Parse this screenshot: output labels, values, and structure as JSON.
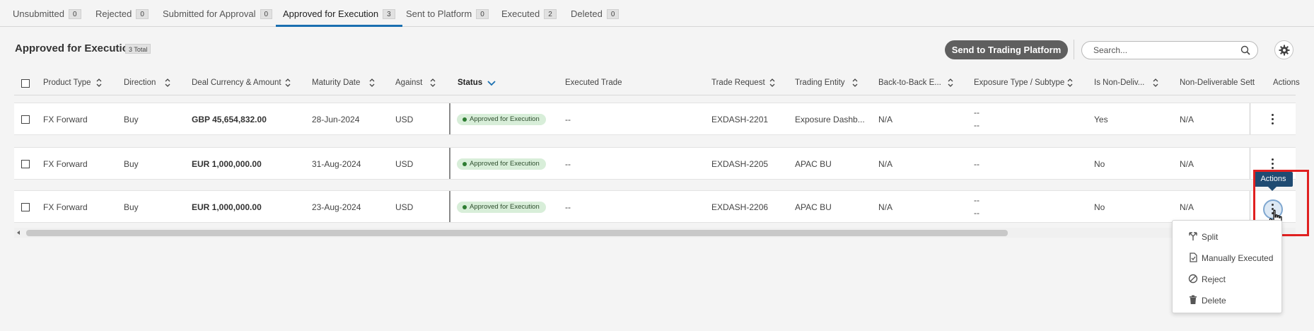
{
  "tabs": [
    {
      "label": "Unsubmitted",
      "count": "0"
    },
    {
      "label": "Rejected",
      "count": "0"
    },
    {
      "label": "Submitted for Approval",
      "count": "0"
    },
    {
      "label": "Approved for Execution",
      "count": "3"
    },
    {
      "label": "Sent to Platform",
      "count": "0"
    },
    {
      "label": "Executed",
      "count": "2"
    },
    {
      "label": "Deleted",
      "count": "0"
    }
  ],
  "header": {
    "title": "Approved for Execution",
    "total": "3 Total",
    "send_button": "Send to Trading Platform",
    "search_placeholder": "Search..."
  },
  "columns": [
    "Product Type",
    "Direction",
    "Deal Currency & Amount",
    "Maturity Date",
    "Against",
    "Status",
    "Executed Trade",
    "Trade Request",
    "Trading Entity",
    "Back-to-Back E...",
    "Exposure Type / Subtype",
    "Is Non-Deliv...",
    "Non-Deliverable Sett",
    "Actions"
  ],
  "rows": [
    {
      "product": "FX Forward",
      "direction": "Buy",
      "amount": "GBP 45,654,832.00",
      "maturity": "28-Jun-2024",
      "against": "USD",
      "status": "Approved for Execution",
      "executed": "--",
      "request": "EXDASH-2201",
      "entity": "Exposure Dashb...",
      "b2b": "N/A",
      "exposure1": "--",
      "exposure2": "--",
      "nondeliv": "Yes",
      "ndsett": "N/A"
    },
    {
      "product": "FX Forward",
      "direction": "Buy",
      "amount": "EUR 1,000,000.00",
      "maturity": "31-Aug-2024",
      "against": "USD",
      "status": "Approved for Execution",
      "executed": "--",
      "request": "EXDASH-2205",
      "entity": "APAC BU",
      "b2b": "N/A",
      "exposure1": "--",
      "exposure2": "",
      "nondeliv": "No",
      "ndsett": "N/A"
    },
    {
      "product": "FX Forward",
      "direction": "Buy",
      "amount": "EUR 1,000,000.00",
      "maturity": "23-Aug-2024",
      "against": "USD",
      "status": "Approved for Execution",
      "executed": "--",
      "request": "EXDASH-2206",
      "entity": "APAC BU",
      "b2b": "N/A",
      "exposure1": "--",
      "exposure2": "--",
      "nondeliv": "No",
      "ndsett": "N/A"
    }
  ],
  "tooltip": "Actions",
  "menu": [
    "Split",
    "Manually Executed",
    "Reject",
    "Delete"
  ],
  "colors": {
    "accent": "#1a6fb0",
    "badge_bg": "#d8eed9",
    "highlight": "#e02020",
    "tooltip_bg": "#1f4b72"
  }
}
